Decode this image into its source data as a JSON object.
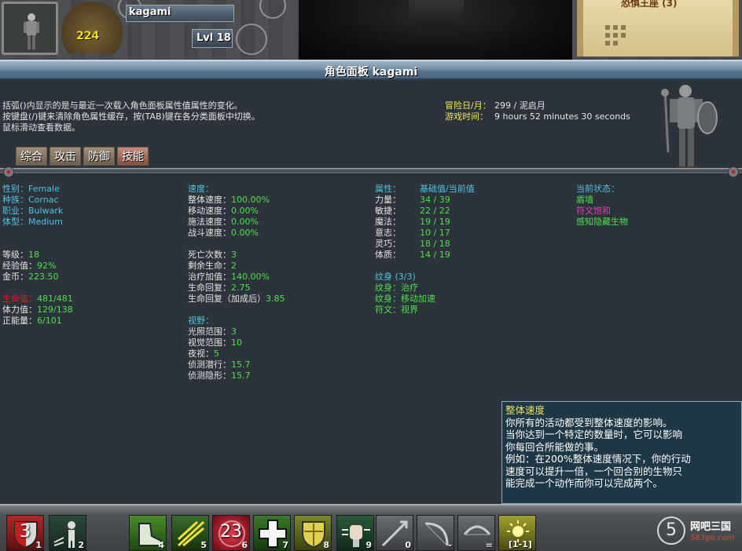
{
  "hud": {
    "gold": "224",
    "player_name": "kagami",
    "level": "Lvl 18",
    "quest_title": "恐惧王座 (3)"
  },
  "panel": {
    "title": "角色面板   kagami",
    "intro": [
      "括弧()内显示的是与最近一次载入角色面板属性值属性的变化。",
      "按键盘(/)键来清除角色属性缓存，按(TAB)键在各分类面板中切换。",
      "鼠标滑动查看数据。"
    ],
    "time": {
      "day_label": "冒险日/月：",
      "day_value": "299 / 泥启月",
      "game_time_label": "游戏时间：",
      "game_time_value": "9 hours 52 minutes 30 seconds"
    },
    "tabs": [
      {
        "label": "综合",
        "active": false
      },
      {
        "label": "攻击",
        "active": false
      },
      {
        "label": "防御",
        "active": false
      },
      {
        "label": "技能",
        "active": true
      }
    ]
  },
  "col1": {
    "sex_label": "性别：",
    "sex": "Female",
    "race_label": "种族：",
    "race": "Cornac",
    "class_label": "职业：",
    "class": "Bulwark",
    "size_label": "体型：",
    "size": "Medium",
    "level_label": "等级：",
    "level": "18",
    "exp_label": "经验值：",
    "exp": "92%",
    "gold_label": "金币：",
    "gold": "223.50",
    "life_label": "生命值：",
    "life": "481/481",
    "stamina_label": "体力值：",
    "stamina": "129/138",
    "positive_label": "正能量：",
    "positive": "6/101"
  },
  "col2": {
    "speed_header": "速度：",
    "speed": [
      {
        "label": "整体速度：",
        "value": "100.00%"
      },
      {
        "label": "移动速度：",
        "value": "0.00%"
      },
      {
        "label": "施法速度：",
        "value": "0.00%"
      },
      {
        "label": "战斗速度：",
        "value": "0.00%"
      }
    ],
    "misc": [
      {
        "label": "死亡次数：",
        "value": "3"
      },
      {
        "label": "剩余生命：",
        "value": "2"
      },
      {
        "label": "治疗加值：",
        "value": "140.00%"
      },
      {
        "label": "生命回复：",
        "value": "2.75"
      },
      {
        "label": "生命回复（加成后）",
        "value": "3.85"
      }
    ],
    "vision_header": "视野：",
    "vision": [
      {
        "label": "光照范围：",
        "value": "3"
      },
      {
        "label": "视觉范围：",
        "value": "10"
      },
      {
        "label": "夜视：",
        "value": "5"
      },
      {
        "label": "侦测潜行：",
        "value": "15.7"
      },
      {
        "label": "侦测隐形：",
        "value": "15.7"
      }
    ]
  },
  "col3": {
    "attr_header": "属性：",
    "attr_sub": "基础值/当前值",
    "attrs": [
      {
        "label": "力量：",
        "value": "34 / 39"
      },
      {
        "label": "敏捷：",
        "value": "22 / 22"
      },
      {
        "label": "魔法：",
        "value": "19 / 19"
      },
      {
        "label": "意志：",
        "value": "10 / 17"
      },
      {
        "label": "灵巧：",
        "value": "18 / 18"
      },
      {
        "label": "体质：",
        "value": "14 / 19"
      }
    ],
    "tattoo_header": "纹身 (3/3)",
    "tattoos": [
      {
        "label": "纹身：",
        "value": "治疗"
      },
      {
        "label": "纹身：",
        "value": "移动加速"
      },
      {
        "label": "符文：",
        "value": "视界"
      }
    ]
  },
  "col4": {
    "status_header": "当前状态：",
    "statuses": [
      {
        "text": "盾墙",
        "color": "#4be04b"
      },
      {
        "text": "符文饱和",
        "color": "#e53fb0"
      },
      {
        "text": "感知隐藏生物",
        "color": "#4be04b"
      }
    ]
  },
  "tooltip": {
    "title": "整体速度",
    "lines": [
      "你所有的活动都受到整体速度的影响。",
      "当你达到一个特定的数量时，它可以影响",
      "你每回合所能做的事。",
      "例如：在200%整体速度情况下，你的行动",
      "速度可以提升一倍，一个回合别的生物只",
      "能完成一个动作而你可以完成两个。"
    ]
  },
  "hotbar": [
    {
      "key": "1",
      "overlay": "3",
      "icon": "shield-red-icon"
    },
    {
      "key": "2",
      "overlay": "",
      "icon": "figure-icon"
    },
    {
      "key": "4",
      "overlay": "",
      "icon": "boot-icon"
    },
    {
      "key": "5",
      "overlay": "",
      "icon": "arrows-icon"
    },
    {
      "key": "6",
      "overlay": "23",
      "icon": "red-orb-icon"
    },
    {
      "key": "7",
      "overlay": "",
      "icon": "cross-icon"
    },
    {
      "key": "8",
      "overlay": "",
      "icon": "shield-gold-icon"
    },
    {
      "key": "9",
      "overlay": "",
      "icon": "fist-icon"
    },
    {
      "key": "0",
      "overlay": "",
      "icon": "arrow-icon"
    },
    {
      "key": "-",
      "overlay": "",
      "icon": "bow-icon"
    },
    {
      "key": "=",
      "overlay": "",
      "icon": "bow-curve-icon"
    },
    {
      "key": "",
      "overlay": "[1-1]",
      "icon": "sun-icon"
    }
  ],
  "logo": {
    "mark": "5",
    "text": "网吧三国",
    "url": "583go.com"
  },
  "colors": {
    "cyan": "#4fc3e0",
    "green": "#4be04b",
    "magenta": "#e53fb0",
    "red": "#e02020",
    "yellow": "#f0e060"
  }
}
